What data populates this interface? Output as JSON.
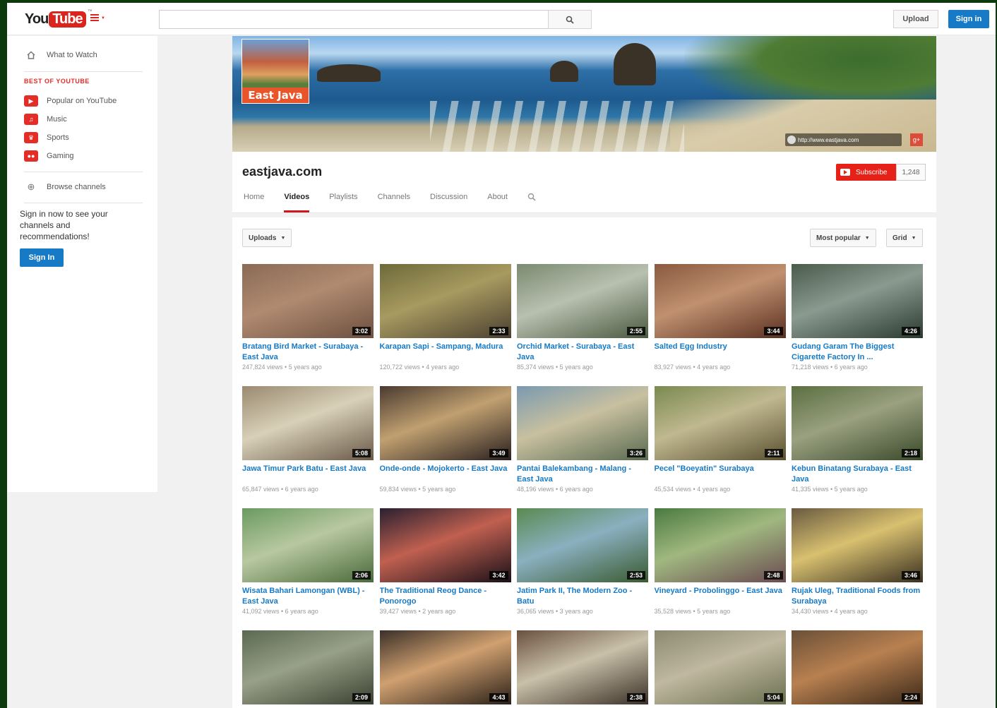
{
  "masthead": {
    "logo_you": "You",
    "logo_tube": "Tube",
    "upload_label": "Upload",
    "signin_label": "Sign in"
  },
  "guide": {
    "what_to_watch": "What to Watch",
    "section_title": "BEST OF YOUTUBE",
    "items": [
      {
        "label": "Popular on YouTube",
        "icon": "popular-icon"
      },
      {
        "label": "Music",
        "icon": "music-icon"
      },
      {
        "label": "Sports",
        "icon": "sports-icon"
      },
      {
        "label": "Gaming",
        "icon": "gaming-icon"
      }
    ],
    "browse_channels": "Browse channels",
    "promo_text": "Sign in now to see your channels and recommendations!",
    "signin_label": "Sign In"
  },
  "channel": {
    "logo_text": "East Java",
    "banner_link": "http://www.eastjava.com",
    "title": "eastjava.com",
    "subscribe_label": "Subscribe",
    "subscriber_count": "1,248",
    "tabs": [
      "Home",
      "Videos",
      "Playlists",
      "Channels",
      "Discussion",
      "About"
    ],
    "active_tab": "Videos"
  },
  "toolbar": {
    "uploads_label": "Uploads",
    "sort_label": "Most popular",
    "view_label": "Grid"
  },
  "videos": [
    {
      "title": "Bratang Bird Market - Surabaya - East Java",
      "meta": "247,824 views • 5 years ago",
      "duration": "3:02",
      "colors": [
        "#8a6a55",
        "#b08a70",
        "#6d5040"
      ]
    },
    {
      "title": "Karapan Sapi - Sampang, Madura",
      "meta": "120,722 views • 4 years ago",
      "duration": "2:33",
      "colors": [
        "#6c6a3a",
        "#a89a60",
        "#4a4030"
      ]
    },
    {
      "title": "Orchid Market - Surabaya - East Java",
      "meta": "85,374 views • 5 years ago",
      "duration": "2:55",
      "colors": [
        "#7a8a70",
        "#b8c0b0",
        "#4a5a40"
      ]
    },
    {
      "title": "Salted Egg Industry",
      "meta": "83,927 views • 4 years ago",
      "duration": "3:44",
      "colors": [
        "#8a5a40",
        "#c09070",
        "#5a3020"
      ]
    },
    {
      "title": "Gudang Garam The Biggest Cigarette Factory In ...",
      "meta": "71,218 views • 6 years ago",
      "duration": "4:26",
      "colors": [
        "#4a5a4a",
        "#8a9a90",
        "#2a3a30"
      ]
    },
    {
      "title": "Jawa Timur Park Batu - East Java",
      "meta": "65,847 views • 6 years ago",
      "duration": "5:08",
      "colors": [
        "#9a8a70",
        "#d8d0b8",
        "#6a5a48"
      ]
    },
    {
      "title": "Onde-onde - Mojokerto - East Java",
      "meta": "59,834 views • 5 years ago",
      "duration": "3:49",
      "colors": [
        "#4a3a30",
        "#c0a070",
        "#2a2020"
      ]
    },
    {
      "title": "Pantai Balekambang - Malang - East Java",
      "meta": "48,196 views • 6 years ago",
      "duration": "3:26",
      "colors": [
        "#7a9ab0",
        "#c8c0a0",
        "#5a6a50"
      ]
    },
    {
      "title": "Pecel \"Boeyatin\" Surabaya",
      "meta": "45,534 views • 4 years ago",
      "duration": "2:11",
      "colors": [
        "#7a8a50",
        "#c0b890",
        "#5a5030"
      ]
    },
    {
      "title": "Kebun Binatang Surabaya - East Java",
      "meta": "41,335 views • 5 years ago",
      "duration": "2:18",
      "colors": [
        "#5a7040",
        "#9aa080",
        "#3a4a2a"
      ]
    },
    {
      "title": "Wisata Bahari Lamongan (WBL) - East Java",
      "meta": "41,092 views • 6 years ago",
      "duration": "2:06",
      "colors": [
        "#6a9a60",
        "#b8c8a0",
        "#4a6a3a"
      ]
    },
    {
      "title": "The Traditional Reog Dance - Ponorogo",
      "meta": "39,427 views • 2 years ago",
      "duration": "3:42",
      "colors": [
        "#2a2030",
        "#c06050",
        "#1a1018"
      ]
    },
    {
      "title": "Jatim Park II, The Modern Zoo - Batu",
      "meta": "36,065 views • 3 years ago",
      "duration": "2:53",
      "colors": [
        "#5a8a50",
        "#8ab0c0",
        "#3a5a30"
      ]
    },
    {
      "title": "Vineyard - Probolinggo - East Java",
      "meta": "35,528 views • 5 years ago",
      "duration": "2:48",
      "colors": [
        "#4a7a40",
        "#a0b880",
        "#6a4a50"
      ]
    },
    {
      "title": "Rujak Uleg, Traditional Foods from Surabaya",
      "meta": "34,430 views • 4 years ago",
      "duration": "3:46",
      "colors": [
        "#6a5a40",
        "#d8c070",
        "#3a3020"
      ]
    },
    {
      "title": "",
      "meta": "",
      "duration": "2:09",
      "colors": [
        "#5a6a50",
        "#98a088",
        "#3a4030"
      ]
    },
    {
      "title": "",
      "meta": "",
      "duration": "4:43",
      "colors": [
        "#3a3028",
        "#d0a070",
        "#2a2018"
      ]
    },
    {
      "title": "",
      "meta": "",
      "duration": "2:38",
      "colors": [
        "#6a5040",
        "#c8c0a8",
        "#3a3028"
      ]
    },
    {
      "title": "",
      "meta": "",
      "duration": "5:04",
      "colors": [
        "#8a8a70",
        "#c0b8a0",
        "#6a7050"
      ]
    },
    {
      "title": "",
      "meta": "",
      "duration": "2:24",
      "colors": [
        "#6a5038",
        "#b88050",
        "#3a2818"
      ]
    }
  ]
}
